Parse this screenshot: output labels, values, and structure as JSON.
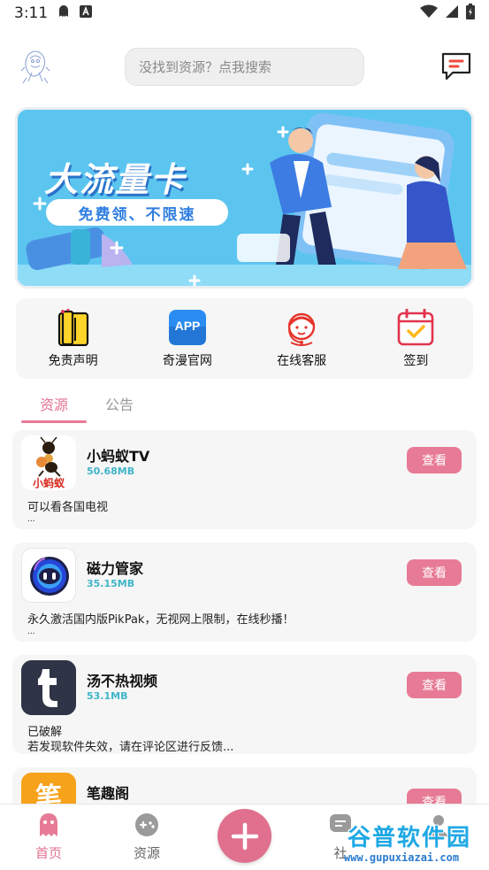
{
  "status_bar": {
    "time": "3:11"
  },
  "header": {
    "search_placeholder": "没找到资源？点我搜索"
  },
  "banner": {
    "title": "大流量卡",
    "subtitle": "免费领、不限速"
  },
  "quick_links": [
    {
      "label": "免责声明",
      "icon": "phone-book-icon"
    },
    {
      "label": "奇漫官网",
      "icon": "app-icon"
    },
    {
      "label": "在线客服",
      "icon": "customer-service-icon"
    },
    {
      "label": "签到",
      "icon": "calendar-check-icon"
    }
  ],
  "tabs": [
    {
      "label": "资源",
      "active": true
    },
    {
      "label": "公告",
      "active": false
    }
  ],
  "resources": [
    {
      "name": "小蚂蚁TV",
      "size": "50.68MB",
      "button": "查看",
      "desc_line1": "可以看各国电视",
      "desc_line2": "..."
    },
    {
      "name": "磁力管家",
      "size": "35.15MB",
      "button": "查看",
      "desc_line1": "永久激活国内版PikPak，无视网上限制，在线秒播！",
      "desc_line2": "..."
    },
    {
      "name": "汤不热视频",
      "size": "53.1MB",
      "button": "查看",
      "desc_line1": "已破解",
      "desc_line2": "若发现软件失效，请在评论区进行反馈..."
    },
    {
      "name": "笔趣阁",
      "size": "",
      "button": "查看",
      "desc_line1": "",
      "desc_line2": ""
    }
  ],
  "bottom_nav": [
    {
      "label": "首页",
      "active": true
    },
    {
      "label": "资源",
      "active": false
    },
    {
      "label": "社",
      "active": false
    }
  ],
  "watermark": {
    "text": "谷普软件园",
    "url": "www.gupuxiazai.com"
  },
  "colors": {
    "accent": "#e77b95",
    "size_text": "#3fb5c8",
    "banner_bg": "#5cc5ef"
  }
}
